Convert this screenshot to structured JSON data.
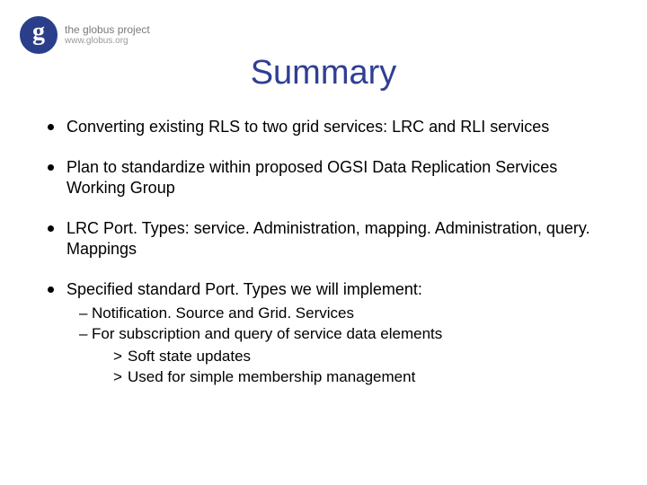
{
  "logo": {
    "line1": "the globus project",
    "line2": "www.globus.org"
  },
  "title": "Summary",
  "bullets": [
    {
      "text": "Converting existing RLS to two grid services:  LRC and RLI services"
    },
    {
      "text": "Plan to standardize within proposed OGSI Data Replication Services Working Group"
    },
    {
      "text": "LRC Port. Types:  service. Administration, mapping. Administration, query. Mappings"
    },
    {
      "text": "Specified standard Port. Types we will implement:",
      "sub": [
        {
          "text": "Notification. Source and Grid. Services"
        },
        {
          "text": "For subscription and query of service data elements",
          "sub": [
            {
              "text": "Soft state updates"
            },
            {
              "text": "Used for simple membership management"
            }
          ]
        }
      ]
    }
  ]
}
